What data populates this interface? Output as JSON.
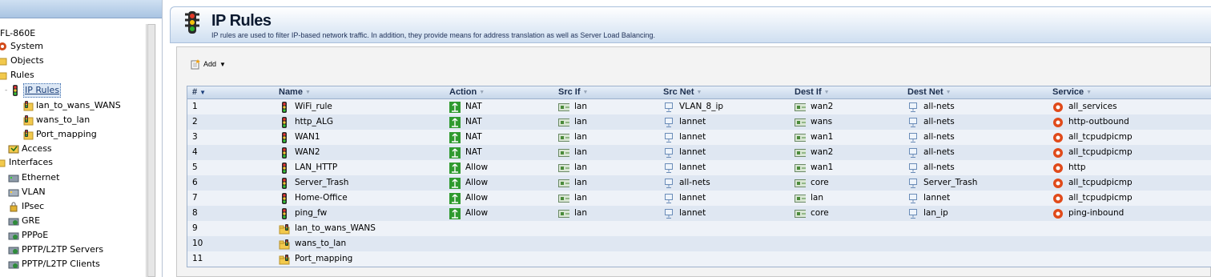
{
  "tree": {
    "device": "FL-860E",
    "items": [
      {
        "label": "System",
        "icon": "system-icon"
      },
      {
        "label": "Objects",
        "icon": "folder-icon"
      },
      {
        "label": "Rules",
        "icon": "rules-icon"
      },
      {
        "label": "IP Rules",
        "icon": "traffic-light-icon"
      },
      {
        "label": "lan_to_wans_WANS",
        "icon": "rule-folder-icon"
      },
      {
        "label": "wans_to_lan",
        "icon": "rule-folder-icon"
      },
      {
        "label": "Port_mapping",
        "icon": "rule-folder-icon"
      },
      {
        "label": "Access",
        "icon": "access-icon"
      },
      {
        "label": "Interfaces",
        "icon": "folder-icon"
      },
      {
        "label": "Ethernet",
        "icon": "ethernet-icon"
      },
      {
        "label": "VLAN",
        "icon": "vlan-icon"
      },
      {
        "label": "IPsec",
        "icon": "ipsec-icon"
      },
      {
        "label": "GRE",
        "icon": "gre-icon"
      },
      {
        "label": "PPPoE",
        "icon": "pppoe-icon"
      },
      {
        "label": "PPTP/L2TP Servers",
        "icon": "pptp-server-icon"
      },
      {
        "label": "PPTP/L2TP Clients",
        "icon": "pptp-client-icon"
      }
    ]
  },
  "page": {
    "title": "IP Rules",
    "description": "IP rules are used to filter IP-based network traffic. In addition, they provide means for address translation as well as Server Load Balancing."
  },
  "toolbar": {
    "add_label": "Add"
  },
  "table": {
    "headers": {
      "num": "#",
      "name": "Name",
      "action": "Action",
      "src_if": "Src If",
      "src_net": "Src Net",
      "dest_if": "Dest If",
      "dest_net": "Dest Net",
      "service": "Service"
    },
    "rows": [
      {
        "num": "1",
        "name": "WiFi_rule",
        "type": "rule",
        "action": "NAT",
        "src_if": "lan",
        "src_net": "VLAN_8_ip",
        "dest_if": "wan2",
        "dest_net": "all-nets",
        "service": "all_services"
      },
      {
        "num": "2",
        "name": "http_ALG",
        "type": "rule",
        "action": "NAT",
        "src_if": "lan",
        "src_net": "lannet",
        "dest_if": "wans",
        "dest_net": "all-nets",
        "service": "http-outbound"
      },
      {
        "num": "3",
        "name": "WAN1",
        "type": "rule",
        "action": "NAT",
        "src_if": "lan",
        "src_net": "lannet",
        "dest_if": "wan1",
        "dest_net": "all-nets",
        "service": "all_tcpudpicmp"
      },
      {
        "num": "4",
        "name": "WAN2",
        "type": "rule",
        "action": "NAT",
        "src_if": "lan",
        "src_net": "lannet",
        "dest_if": "wan2",
        "dest_net": "all-nets",
        "service": "all_tcpudpicmp"
      },
      {
        "num": "5",
        "name": "LAN_HTTP",
        "type": "rule",
        "action": "Allow",
        "src_if": "lan",
        "src_net": "lannet",
        "dest_if": "wan1",
        "dest_net": "all-nets",
        "service": "http"
      },
      {
        "num": "6",
        "name": "Server_Trash",
        "type": "rule",
        "action": "Allow",
        "src_if": "lan",
        "src_net": "all-nets",
        "dest_if": "core",
        "dest_net": "Server_Trash",
        "service": "all_tcpudpicmp"
      },
      {
        "num": "7",
        "name": "Home-Office",
        "type": "rule",
        "action": "Allow",
        "src_if": "lan",
        "src_net": "lannet",
        "dest_if": "lan",
        "dest_net": "lannet",
        "service": "all_tcpudpicmp"
      },
      {
        "num": "8",
        "name": "ping_fw",
        "type": "rule",
        "action": "Allow",
        "src_if": "lan",
        "src_net": "lannet",
        "dest_if": "core",
        "dest_net": "lan_ip",
        "service": "ping-inbound"
      },
      {
        "num": "9",
        "name": "lan_to_wans_WANS",
        "type": "folder"
      },
      {
        "num": "10",
        "name": "wans_to_lan",
        "type": "folder"
      },
      {
        "num": "11",
        "name": "Port_mapping",
        "type": "folder"
      }
    ]
  },
  "colors": {
    "action_icon": "#2f9a2f",
    "header_bg": "#c7d7ea",
    "row_odd": "#dfe7f2",
    "row_even": "#eef2f8"
  }
}
